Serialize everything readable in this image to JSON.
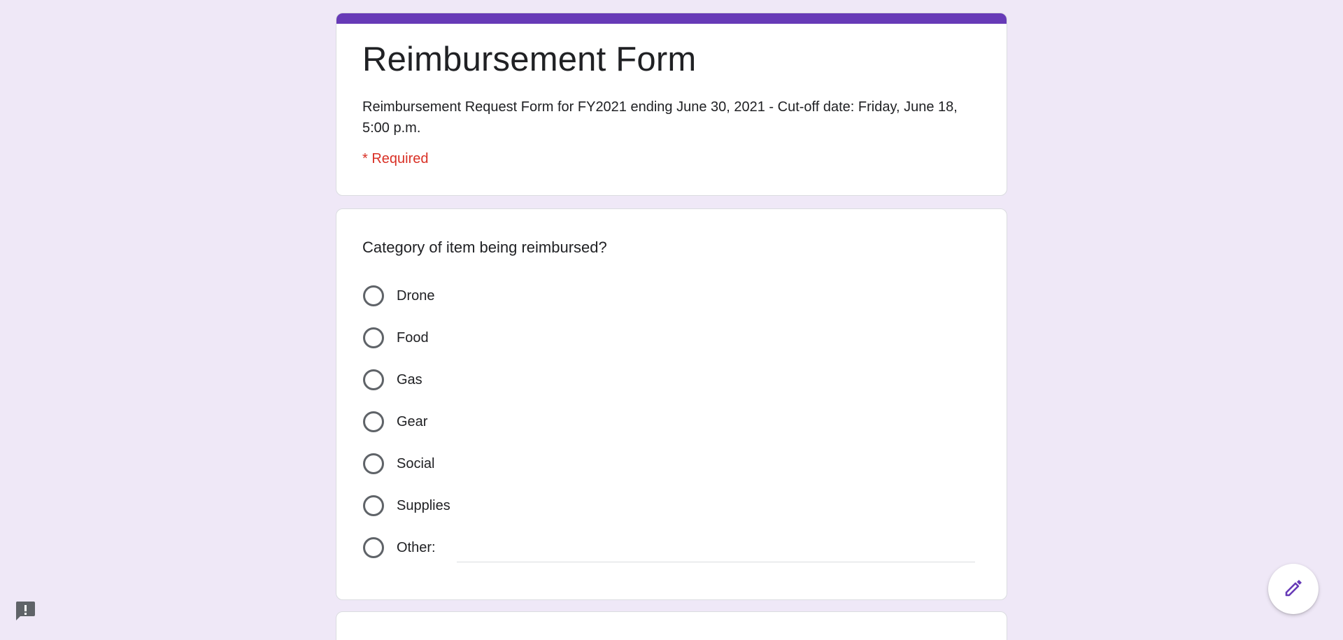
{
  "form": {
    "title": "Reimbursement Form",
    "description": "Reimbursement Request Form for FY2021 ending June 30, 2021 - Cut-off date: Friday, June 18, 5:00 p.m.",
    "required_note": "* Required"
  },
  "question": {
    "title": "Category of item being reimbursed?",
    "options": [
      {
        "label": "Drone"
      },
      {
        "label": "Food"
      },
      {
        "label": "Gas"
      },
      {
        "label": "Gear"
      },
      {
        "label": "Social"
      },
      {
        "label": "Supplies"
      },
      {
        "label": "Other:"
      }
    ],
    "other_value": ""
  },
  "icons": {
    "feedback": "feedback-icon",
    "edit": "pencil-icon"
  },
  "colors": {
    "accent": "#673ab7",
    "background": "#efe8f7",
    "required": "#d93025"
  }
}
